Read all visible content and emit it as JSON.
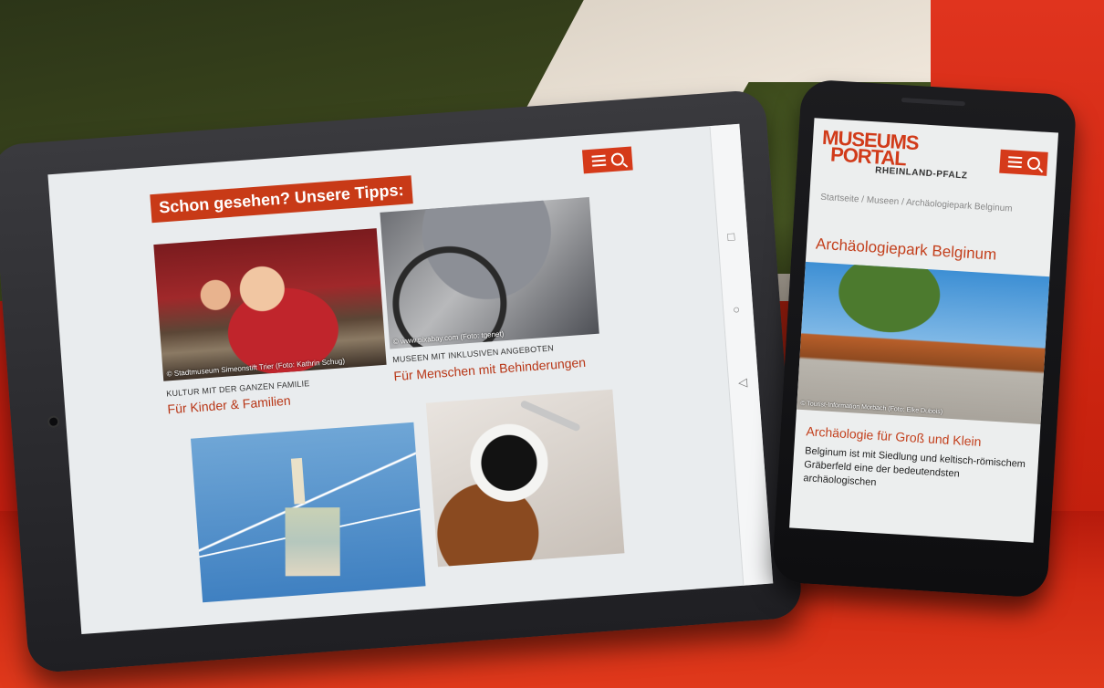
{
  "tablet": {
    "heading": "Schon gesehen? Unsere Tipps:",
    "cards": [
      {
        "credit": "© Stadtmuseum Simeonstift Trier (Foto: Kathrin Schug)",
        "kicker": "KULTUR MIT DER GANZEN FAMILIE",
        "title": "Für Kinder & Familien"
      },
      {
        "credit": "© www.pixabay.com (Foto: tgenet)",
        "kicker": "MUSEEN MIT INKLUSIVEN ANGEBOTEN",
        "title": "Für Menschen mit Behinderungen"
      }
    ],
    "nav": {
      "square": "□",
      "circle": "○",
      "back": "◁"
    }
  },
  "phone": {
    "logo_line1": "MUSEUMS",
    "logo_line2": "PORTAL",
    "logo_sub": "RHEINLAND-PFALZ",
    "breadcrumb": "Startseite / Museen / Archäologiepark Belginum",
    "page_title": "Archäologiepark Belginum",
    "image_credit": "© Tourist-Information Morbach (Foto: Elke Dubois)",
    "subheading": "Archäologie für Groß und Klein",
    "body": "Belginum ist mit Siedlung und keltisch-römischem Gräberfeld eine der bedeutendsten archäologischen"
  },
  "colors": {
    "accent": "#d53a1a",
    "accent_text": "#c3401d",
    "backdrop_red": "#c41e10"
  }
}
